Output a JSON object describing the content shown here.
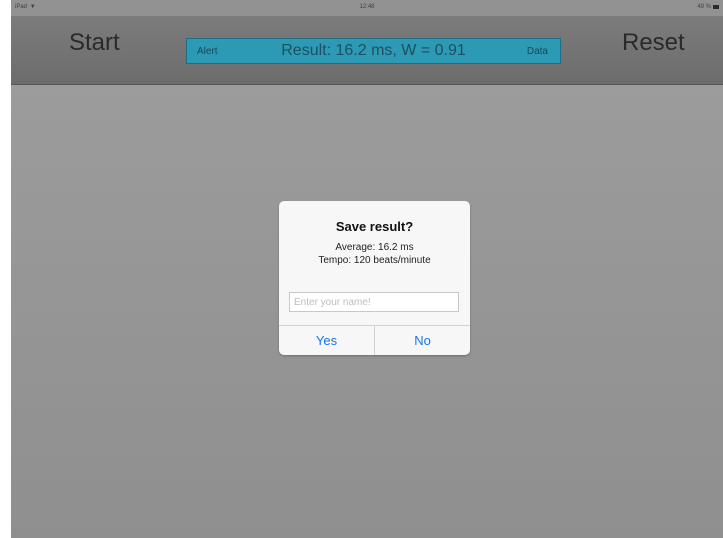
{
  "status_bar": {
    "device": "iPad",
    "time": "12:48",
    "battery": "49 %"
  },
  "navbar": {
    "start_label": "Start",
    "reset_label": "Reset",
    "result_panel": {
      "left_label": "Alert",
      "result_text": "Result: 16.2 ms,  W = 0.91",
      "right_label": "Data",
      "color": "#2c9ab4"
    }
  },
  "dialog": {
    "title": "Save result?",
    "line1": "Average: 16.2 ms",
    "line2": "Tempo: 120 beats/minute",
    "input_value": "",
    "input_placeholder": "Enter your name!",
    "yes_label": "Yes",
    "no_label": "No",
    "button_color": "#1a73e8"
  }
}
